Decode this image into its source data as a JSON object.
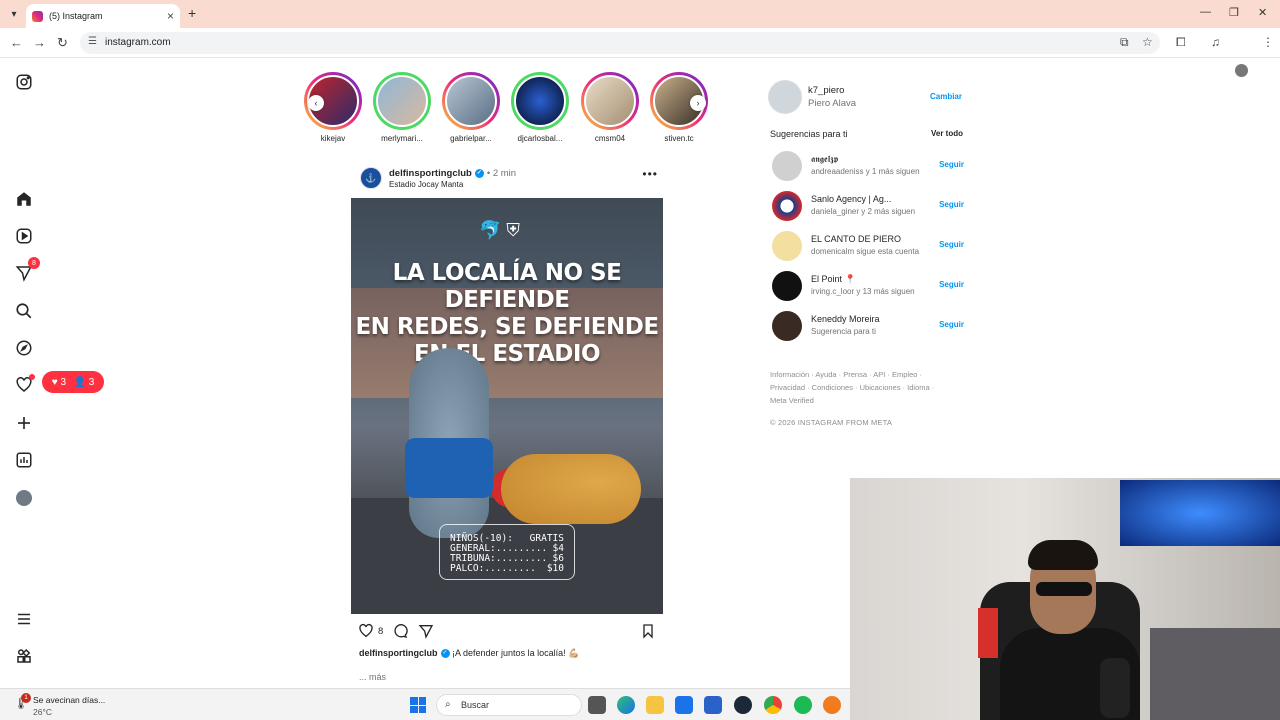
{
  "browser": {
    "tab_title": "(5) Instagram",
    "new_tab": "+",
    "url": "instagram.com"
  },
  "nav": {
    "notifications_badge": "8",
    "activity": {
      "likes": "3",
      "follows": "3"
    }
  },
  "stories": [
    {
      "name": "kikejav",
      "seen": false
    },
    {
      "name": "merlymari...",
      "seen": true
    },
    {
      "name": "gabrielpar...",
      "seen": false
    },
    {
      "name": "djcarlosbal...",
      "seen": true
    },
    {
      "name": "cmsm04",
      "seen": false
    },
    {
      "name": "stiven.tc",
      "seen": false
    }
  ],
  "post": {
    "username": "delfinsportingclub",
    "time": "• 2 min",
    "location": "Estadio Jocay Manta",
    "headline_lines": [
      "LA LOCALÍA NO SE DEFIENDE",
      "EN REDES, SE DEFIENDE",
      "EN EL ESTADIO"
    ],
    "prices": [
      {
        "label": "NIÑOS(-10):",
        "value": "GRATIS"
      },
      {
        "label": "GENERAL:.........",
        "value": "$4"
      },
      {
        "label": "TRIBUNA:.........",
        "value": "$6"
      },
      {
        "label": "PALCO:.........",
        "value": "$10"
      }
    ],
    "likes": "8",
    "caption_user": "delfinsportingclub",
    "caption_text": "¡A defender juntos la localía! 💪🏼",
    "more": "... más"
  },
  "profile": {
    "username": "k7_piero",
    "name": "Piero Alava",
    "switch": "Cambiar"
  },
  "suggestions": {
    "title": "Sugerencias para ti",
    "see_all": "Ver todo",
    "follow_label": "Seguir",
    "items": [
      {
        "name": "𝖆𝖓𝖌𝖊𝖑𝖟𝖕",
        "sub": "andreaadeniss y 1 más siguen",
        "color": "#d0d0d0"
      },
      {
        "name": "Sanlo Agency | Ag...",
        "sub": "daniela_giner y 2 más siguen",
        "color": "#1e3c8c"
      },
      {
        "name": "EL CANTO DE PIERO",
        "sub": "domenicalm sigue esta cuenta",
        "color": "#f3e0a0"
      },
      {
        "name": "El Point 📍",
        "sub": "irving.c_loor y 13 más siguen",
        "color": "#111111"
      },
      {
        "name": "Keneddy Moreira",
        "sub": "Sugerencia para ti",
        "color": "#3a2a24"
      }
    ]
  },
  "footer": {
    "links": "Información · Ayuda · Prensa · API · Empleo · Privacidad · Condiciones · Ubicaciones · Idioma · Meta Verified",
    "copyright": "© 2026 INSTAGRAM FROM META"
  },
  "taskbar": {
    "weather_title": "Se avecinan días...",
    "weather_temp": "26°C",
    "weather_badge": "1",
    "search_placeholder": "Buscar"
  }
}
